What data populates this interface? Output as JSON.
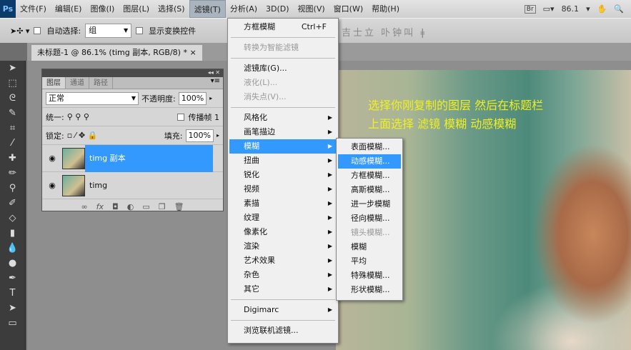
{
  "menubar": {
    "logo": "Ps",
    "items": [
      "文件(F)",
      "编辑(E)",
      "图像(I)",
      "图层(L)",
      "选择(S)",
      "滤镜(T)",
      "分析(A)",
      "3D(D)",
      "视图(V)",
      "窗口(W)",
      "帮助(H)"
    ],
    "br": "Br",
    "zoom": "86.1"
  },
  "options": {
    "auto_select": "自动选择:",
    "group": "组",
    "show_transform": "显示变换控件"
  },
  "document": {
    "tab": "未标题-1 @ 86.1% (timg 副本, RGB/8) *",
    "hint_line1": "选择你刚复制的图层 然后在标题栏",
    "hint_line2": "上面选择 滤镜 模糊 动感模糊"
  },
  "layers_panel": {
    "tabs": [
      "图层",
      "通道",
      "路径"
    ],
    "blend": "正常",
    "opacity_label": "不透明度:",
    "opacity": "100%",
    "unify": "统一:",
    "propagate": "传播帧 1",
    "lock": "锁定:",
    "fill_label": "填充:",
    "fill": "100%",
    "layers": [
      "timg 副本",
      "timg"
    ]
  },
  "filter_menu": {
    "last": "方框模糊",
    "last_shortcut": "Ctrl+F",
    "smart": "转换为智能滤镜",
    "gallery": "滤镜库(G)...",
    "liquify": "液化(L)...",
    "vanish": "消失点(V)...",
    "groups": [
      "风格化",
      "画笔描边",
      "模糊",
      "扭曲",
      "锐化",
      "视频",
      "素描",
      "纹理",
      "像素化",
      "渲染",
      "艺术效果",
      "杂色",
      "其它"
    ],
    "digimarc": "Digimarc",
    "browse": "浏览联机滤镜..."
  },
  "blur_submenu": [
    "表面模糊...",
    "动感模糊...",
    "方框模糊...",
    "高斯模糊...",
    "进一步模糊",
    "径向模糊...",
    "镜头模糊...",
    "模糊",
    "平均",
    "特殊模糊...",
    "形状模糊..."
  ]
}
